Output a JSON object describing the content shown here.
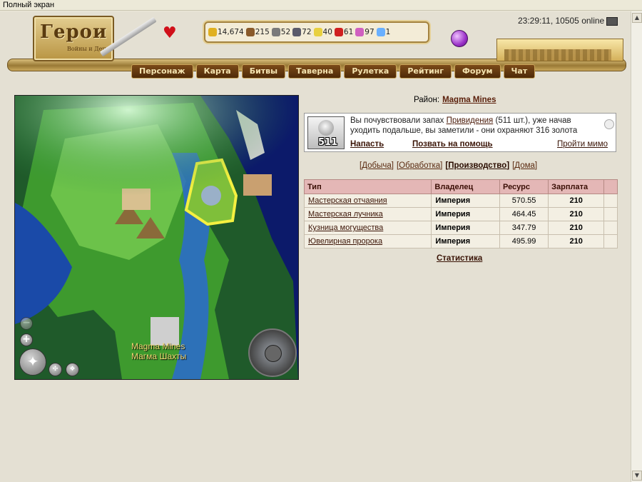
{
  "window": {
    "fullscreen_label": "Полный экран"
  },
  "header": {
    "logo_title": "Герои",
    "logo_subtitle": "Войны и Денег",
    "clock": "23:29:11, 10505 online",
    "resources": [
      {
        "icon": "gold-icon",
        "value": "14,674",
        "color": "#e0b020"
      },
      {
        "icon": "wood-icon",
        "value": "215",
        "color": "#8a5a2a"
      },
      {
        "icon": "ore-icon",
        "value": "52",
        "color": "#7a7a7a"
      },
      {
        "icon": "mercury-icon",
        "value": "72",
        "color": "#5a5a6a"
      },
      {
        "icon": "sulfur-icon",
        "value": "40",
        "color": "#e8d040"
      },
      {
        "icon": "crystal-icon",
        "value": "61",
        "color": "#d02020"
      },
      {
        "icon": "gems-icon",
        "value": "97",
        "color": "#d060c0"
      },
      {
        "icon": "diamond-icon",
        "value": "1",
        "color": "#6ab0ff"
      }
    ]
  },
  "nav": [
    "Персонаж",
    "Карта",
    "Битвы",
    "Таверна",
    "Рулетка",
    "Рейтинг",
    "Форум",
    "Чат"
  ],
  "map": {
    "label_en": "Magma Mines",
    "label_ru": "Магма Шахты"
  },
  "district": {
    "label": "Район:",
    "name": "Magma Mines"
  },
  "event": {
    "ghost_count": "511",
    "text_before": "Вы почувствовали запах ",
    "creature": "Привидения",
    "text_after": " (511 шт.), уже начав уходить подальше, вы заметили - они охраняют 316 золота",
    "attack": "Напасть",
    "call_help": "Позвать на помощь",
    "pass_by": "Пройти мимо"
  },
  "tabs": [
    "Добыча",
    "Обработка",
    "Производство",
    "Дома"
  ],
  "active_tab": "Производство",
  "table": {
    "headers": [
      "Тип",
      "Владелец",
      "Ресурс",
      "Зарплата"
    ],
    "rows": [
      {
        "type": "Мастерская отчаяния",
        "owner": "Империя",
        "resource": "570.55",
        "salary": "210"
      },
      {
        "type": "Мастерская лучника",
        "owner": "Империя",
        "resource": "464.45",
        "salary": "210"
      },
      {
        "type": "Кузница могущества",
        "owner": "Империя",
        "resource": "347.79",
        "salary": "210"
      },
      {
        "type": "Ювелирная пророка",
        "owner": "Империя",
        "resource": "495.99",
        "salary": "210"
      }
    ]
  },
  "statistics_link": "Статистика"
}
